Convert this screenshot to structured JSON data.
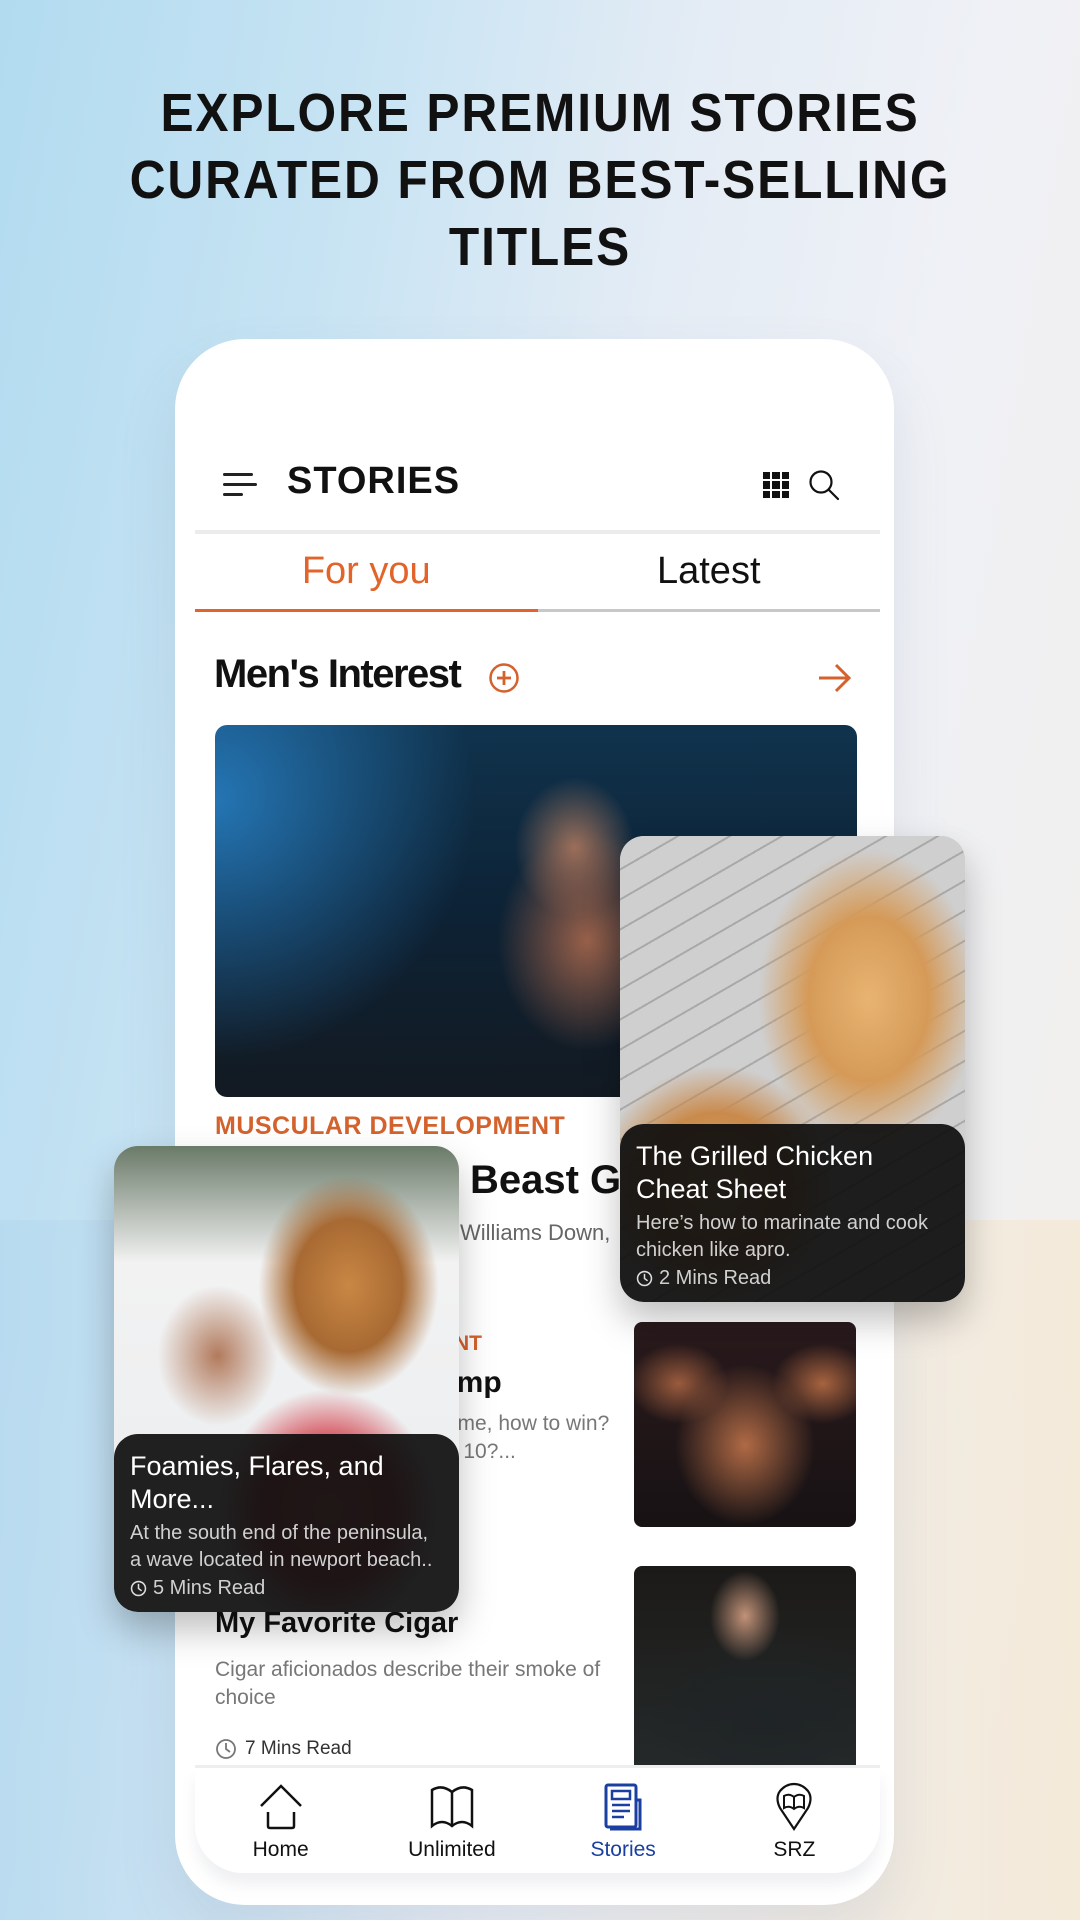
{
  "headline": "EXPLORE PREMIUM STORIES CURATED FROM BEST-SELLING TITLES",
  "app": {
    "title": "STORIES",
    "icons": {
      "menu": "menu-icon",
      "grid": "grid-icon",
      "search": "search-icon"
    }
  },
  "tabs": [
    {
      "label": "For you",
      "active": true
    },
    {
      "label": "Latest",
      "active": false
    }
  ],
  "section": {
    "title": "Men's Interest",
    "follow_icon": "plus-circle-icon",
    "more_icon": "arrow-right-icon"
  },
  "stories": [
    {
      "kicker": "MUSCULAR DEVELOPMENT",
      "title_visible": "Beast Ga",
      "subtitle_visible": "Williams Down,"
    },
    {
      "kicker_visible": "ENT",
      "title_visible": "amp",
      "subtitle_visible": "g me, how to win? 5, 10?..."
    },
    {
      "title": "My Favorite Cigar",
      "subtitle": "Cigar aficionados describe their smoke of choice",
      "read_time": "7 Mins Read"
    }
  ],
  "overlay_cards": [
    {
      "title": "The Grilled Chicken Cheat Sheet",
      "subtitle": "Here’s how to marinate and cook chicken like apro.",
      "read_time": "2 Mins Read"
    },
    {
      "title": "Foamies, Flares, and More...",
      "subtitle": "At the south end of the peninsula, a wave located in newport beach..",
      "read_time": "5 Mins Read"
    }
  ],
  "bottom_nav": [
    {
      "label": "Home",
      "icon": "home-icon",
      "active": false
    },
    {
      "label": "Unlimited",
      "icon": "book-open-icon",
      "active": false
    },
    {
      "label": "Stories",
      "icon": "newspaper-icon",
      "active": true
    },
    {
      "label": "SRZ",
      "icon": "map-pin-book-icon",
      "active": false
    }
  ],
  "colors": {
    "accent": "#e2642a",
    "active_nav": "#1a3fa0",
    "text": "#111111"
  }
}
